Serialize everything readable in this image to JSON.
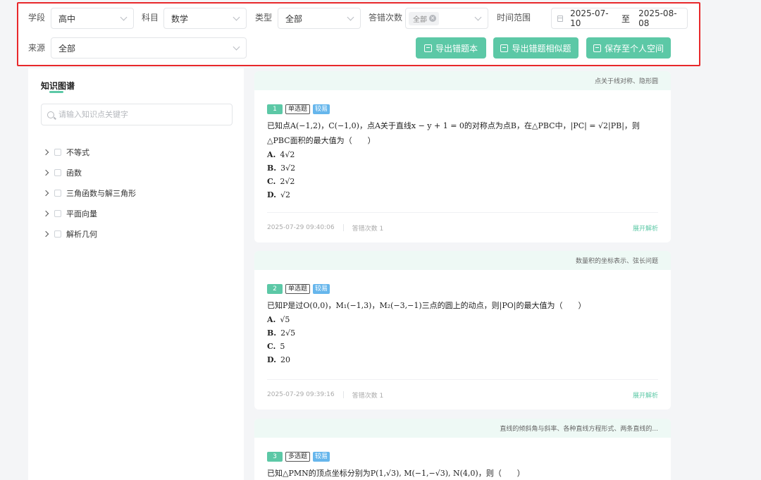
{
  "filters": {
    "stage": {
      "label": "学段",
      "value": "高中"
    },
    "subject": {
      "label": "科目",
      "value": "数学"
    },
    "type": {
      "label": "类型",
      "value": "全部"
    },
    "wrong_count": {
      "label": "答错次数",
      "chip": "全部"
    },
    "time_range": {
      "label": "时间范围",
      "start": "2025-07-10",
      "sep": "至",
      "end": "2025-08-08"
    },
    "source": {
      "label": "来源",
      "value": "全部"
    }
  },
  "buttons": {
    "export_wrong": "导出错题本",
    "export_similar": "导出错题相似题",
    "save_space": "保存至个人空间"
  },
  "sidebar": {
    "title": "知识图谱",
    "search_placeholder": "请输入知识点关键字",
    "items": [
      "不等式",
      "函数",
      "三角函数与解三角形",
      "平面向量",
      "解析几何"
    ]
  },
  "questions": [
    {
      "num": "1",
      "qtype": "单选题",
      "difficulty": "较易",
      "tags": "点关于线对称、隐形圆",
      "stem": "已知点A(−1,2)，C(−1,0)，点A关于直线x − y + 1 = 0的对称点为点B，在△PBC中，|PC| = √2|PB|，则△PBC面积的最大值为（　　）",
      "options": [
        [
          "A.",
          "4√2"
        ],
        [
          "B.",
          "3√2"
        ],
        [
          "C.",
          "2√2"
        ],
        [
          "D.",
          "√2"
        ]
      ],
      "time": "2025-07-29 09:40:06",
      "count": "答错次数 1",
      "expand": "展开解析"
    },
    {
      "num": "2",
      "qtype": "单选题",
      "difficulty": "较易",
      "tags": "数量积的坐标表示、弦长问题",
      "stem": "已知P是过O(0,0)，M₁(−1,3)，M₂(−3,−1)三点的圆上的动点，则|PO|的最大值为（　　）",
      "options": [
        [
          "A.",
          "√5"
        ],
        [
          "B.",
          "2√5"
        ],
        [
          "C.",
          "5"
        ],
        [
          "D.",
          "20"
        ]
      ],
      "time": "2025-07-29 09:39:16",
      "count": "答错次数 1",
      "expand": "展开解析"
    },
    {
      "num": "3",
      "qtype": "多选题",
      "difficulty": "较易",
      "tags": "直线的倾斜角与斜率、各种直线方程形式、两条直线的...",
      "stem": "已知△PMN的顶点坐标分别为P(1,√3), M(−1,−√3), N(4,0)，则（　　）"
    }
  ]
}
